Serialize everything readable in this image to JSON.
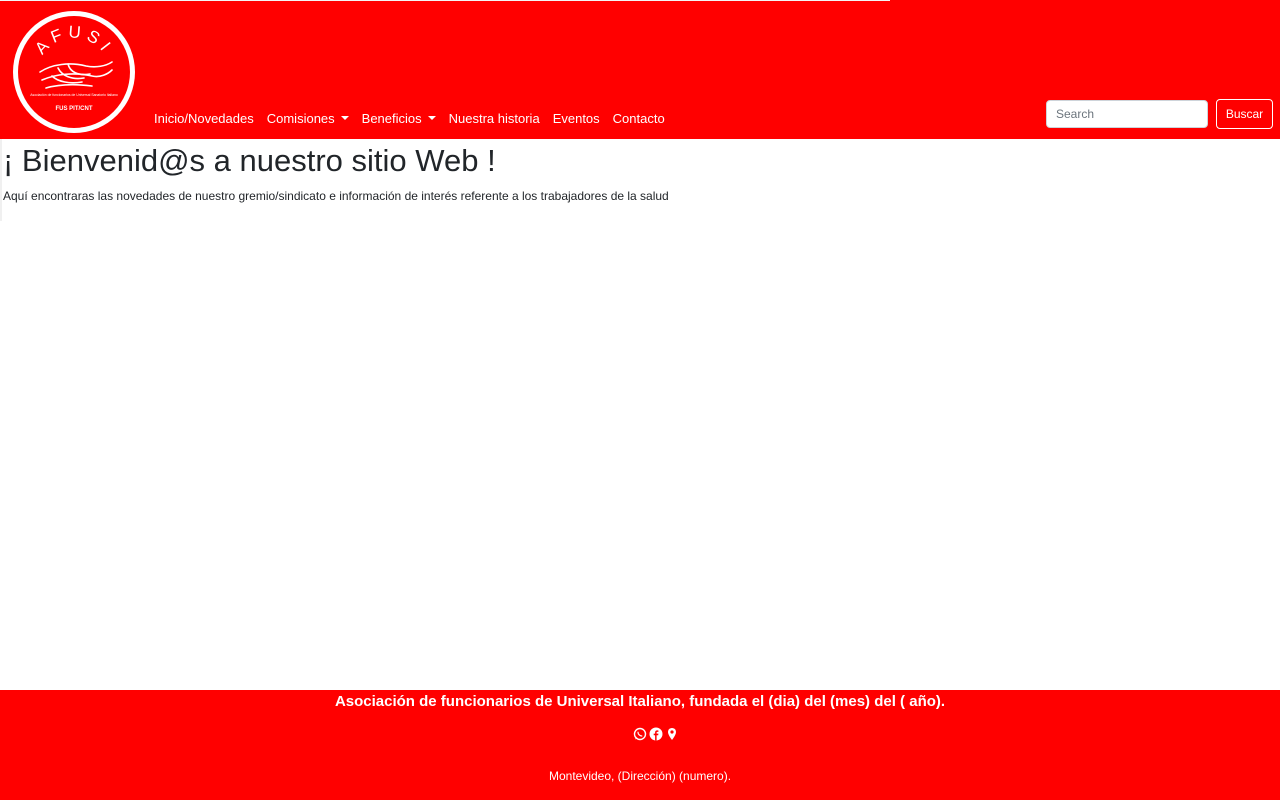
{
  "brand": {
    "logo_text": "AFUSI",
    "logo_caption": "Asociación de funcionarios de Universal Sanatorio Italiano",
    "logo_footer": "FUS PIT/CNT"
  },
  "nav": {
    "items": [
      {
        "label": "Inicio/Novedades",
        "dropdown": false
      },
      {
        "label": "Comisiones",
        "dropdown": true
      },
      {
        "label": "Beneficios",
        "dropdown": true
      },
      {
        "label": "Nuestra historia",
        "dropdown": false
      },
      {
        "label": "Eventos",
        "dropdown": false
      },
      {
        "label": "Contacto",
        "dropdown": false
      }
    ]
  },
  "search": {
    "placeholder": "Search",
    "button_label": "Buscar"
  },
  "main": {
    "title": "¡ Bienvenid@s a nuestro sitio Web !",
    "intro": "Aquí encontraras las novedades de nuestro gremio/sindicato e información de interés referente a los trabajadores de la salud"
  },
  "footer": {
    "title": "Asociación de funcionarios de Universal Italiano, fundada el (dia) del (mes) del ( año).",
    "icons": [
      "whatsapp-icon",
      "facebook-icon",
      "location-pin-icon"
    ],
    "address": "Montevideo, (Dirección) (numero)."
  },
  "colors": {
    "brand_red": "#ff0000",
    "text": "#212529",
    "white": "#ffffff"
  }
}
